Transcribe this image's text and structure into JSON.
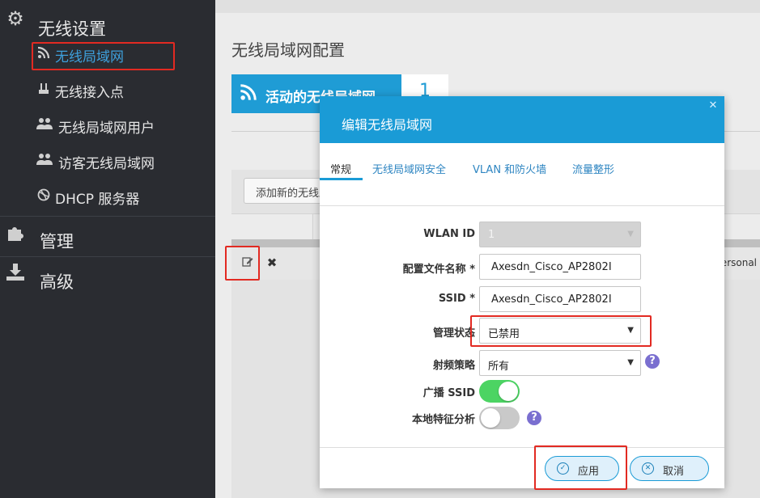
{
  "sidebar": {
    "sections": [
      {
        "label": "无线设置",
        "icon": "gear-icon"
      },
      {
        "label": "管理",
        "icon": "puzzle-icon"
      },
      {
        "label": "高级",
        "icon": "download-icon"
      }
    ],
    "items": [
      {
        "label": "无线局域网",
        "icon": "wifi-rss-icon",
        "active": true
      },
      {
        "label": "无线接入点",
        "icon": "access-point-icon",
        "active": false
      },
      {
        "label": "无线局域网用户",
        "icon": "users-icon",
        "active": false
      },
      {
        "label": "访客无线局域网",
        "icon": "guest-users-icon",
        "active": false
      },
      {
        "label": "DHCP 服务器",
        "icon": "dhcp-globe-icon",
        "active": false
      }
    ]
  },
  "main": {
    "title": "无线局域网配置",
    "active_wlan_tile": {
      "label": "活动的无线局域网",
      "count": "1"
    },
    "add_button_label": "添加新的无线局域网",
    "row": {
      "security_partial": "Personal"
    }
  },
  "modal": {
    "title": "编辑无线局域网",
    "tabs": [
      "常规",
      "无线局域网安全",
      "VLAN 和防火墙",
      "流量整形"
    ],
    "active_tab": "常规",
    "fields": {
      "wlan_id": {
        "label": "WLAN ID",
        "value": "1"
      },
      "profile_name": {
        "label": "配置文件名称 *",
        "value": "Axesdn_Cisco_AP2802I"
      },
      "ssid": {
        "label": "SSID *",
        "value": "Axesdn_Cisco_AP2802I"
      },
      "admin_state": {
        "label": "管理状态",
        "value": "已禁用"
      },
      "radio_policy": {
        "label": "射频策略",
        "value": "所有"
      },
      "broadcast_ssid": {
        "label": "广播 SSID",
        "on": true
      },
      "local_profiling": {
        "label": "本地特征分析",
        "on": false
      }
    },
    "apply_label": "应用",
    "cancel_label": "取消"
  },
  "colors": {
    "accent": "#1a9bd6",
    "sidebar_bg": "#2a2c31",
    "active_link": "#3ea0dc",
    "toggle_on": "#4cd463",
    "help_icon": "#7a6fd0",
    "highlight_box": "#e22a22"
  }
}
